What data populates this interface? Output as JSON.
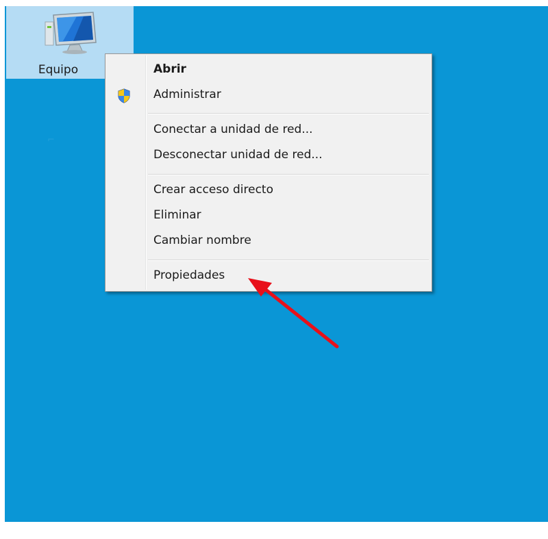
{
  "desktop": {
    "background": "#0a96d6",
    "icon": {
      "name": "computer-icon",
      "label": "Equipo"
    }
  },
  "context_menu": {
    "items": [
      {
        "label": "Abrir",
        "bold": true
      },
      {
        "label": "Administrar",
        "icon": "shield-icon"
      },
      {
        "label": "Conectar a unidad de red..."
      },
      {
        "label": "Desconectar unidad de red..."
      },
      {
        "label": "Crear acceso directo"
      },
      {
        "label": "Eliminar"
      },
      {
        "label": "Cambiar nombre"
      },
      {
        "label": "Propiedades"
      }
    ]
  },
  "annotation": {
    "arrow_color": "#e8101a",
    "target": "Propiedades"
  }
}
